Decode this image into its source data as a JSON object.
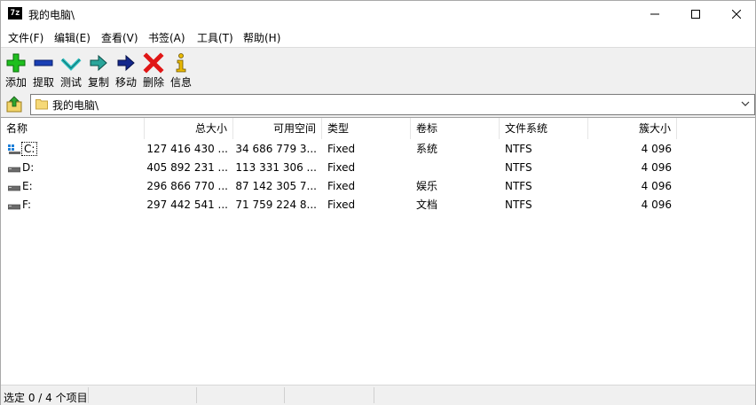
{
  "window": {
    "title": "我的电脑\\",
    "app_icon_text": "7z"
  },
  "menu": [
    "文件(F)",
    "编辑(E)",
    "查看(V)",
    "书签(A)",
    "工具(T)",
    "帮助(H)"
  ],
  "toolbar": [
    {
      "label": "添加",
      "icon": "add-icon"
    },
    {
      "label": "提取",
      "icon": "extract-icon"
    },
    {
      "label": "测试",
      "icon": "test-icon"
    },
    {
      "label": "复制",
      "icon": "copy-icon"
    },
    {
      "label": "移动",
      "icon": "move-icon"
    },
    {
      "label": "删除",
      "icon": "delete-icon"
    },
    {
      "label": "信息",
      "icon": "info-icon"
    }
  ],
  "address": {
    "path": "我的电脑\\"
  },
  "columns": [
    "名称",
    "总大小",
    "可用空间",
    "类型",
    "卷标",
    "文件系统",
    "簇大小"
  ],
  "rows": [
    {
      "name": "C:",
      "total": "127 416 430 ...",
      "free": "34 686 779 3...",
      "type": "Fixed",
      "label": "系统",
      "fs": "NTFS",
      "cluster": "4 096"
    },
    {
      "name": "D:",
      "total": "405 892 231 ...",
      "free": "113 331 306 ...",
      "type": "Fixed",
      "label": "",
      "fs": "NTFS",
      "cluster": "4 096"
    },
    {
      "name": "E:",
      "total": "296 866 770 ...",
      "free": "87 142 305 7...",
      "type": "Fixed",
      "label": "娱乐",
      "fs": "NTFS",
      "cluster": "4 096"
    },
    {
      "name": "F:",
      "total": "297 442 541 ...",
      "free": "71 759 224 8...",
      "type": "Fixed",
      "label": "文档",
      "fs": "NTFS",
      "cluster": "4 096"
    }
  ],
  "status": {
    "text": "选定 0 / 4 个项目"
  }
}
